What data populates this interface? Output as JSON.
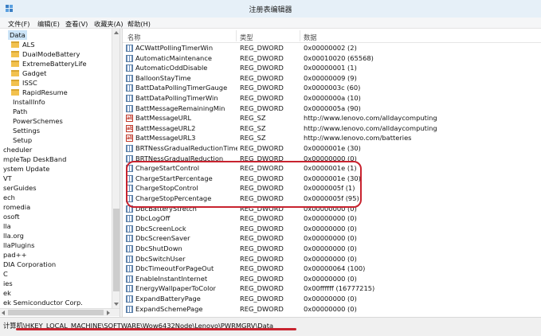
{
  "window": {
    "title": "注册表编辑器"
  },
  "menu": [
    {
      "label": "文件(F)"
    },
    {
      "label": "编辑(E)"
    },
    {
      "label": "查看(V)"
    },
    {
      "label": "收藏夹(A)"
    },
    {
      "label": "帮助(H)"
    }
  ],
  "tree": {
    "items": [
      {
        "label": "Data",
        "folder": false,
        "selected": true
      },
      {
        "label": "ALS",
        "folder": true
      },
      {
        "label": "DualModeBattery",
        "folder": true
      },
      {
        "label": "ExtremeBatteryLife",
        "folder": true
      },
      {
        "label": "Gadget",
        "folder": true
      },
      {
        "label": "ISSC",
        "folder": true
      },
      {
        "label": "RapidResume",
        "folder": true
      },
      {
        "label": "InstallInfo",
        "folder": false
      },
      {
        "label": "Path",
        "folder": false
      },
      {
        "label": "PowerSchemes",
        "folder": false
      },
      {
        "label": "Settings",
        "folder": false
      },
      {
        "label": "Setup",
        "folder": false
      },
      {
        "label": "cheduler",
        "folder": false
      },
      {
        "label": "mpleTap DeskBand",
        "folder": false
      },
      {
        "label": "ystem Update",
        "folder": false
      },
      {
        "label": "VT",
        "folder": false
      },
      {
        "label": "serGuides",
        "folder": false
      },
      {
        "label": "ech",
        "folder": false
      },
      {
        "label": "romedia",
        "folder": false
      },
      {
        "label": "osoft",
        "folder": false
      },
      {
        "label": "lla",
        "folder": false
      },
      {
        "label": "lla.org",
        "folder": false
      },
      {
        "label": "llaPlugins",
        "folder": false
      },
      {
        "label": "pad++",
        "folder": false
      },
      {
        "label": "DIA Corporation",
        "folder": false
      },
      {
        "label": "C",
        "folder": false
      },
      {
        "label": "ies",
        "folder": false
      },
      {
        "label": "ek",
        "folder": false
      },
      {
        "label": "ek Semiconductor Corp.",
        "folder": false
      }
    ]
  },
  "list": {
    "columns": {
      "name": "名称",
      "type": "类型",
      "data": "数据"
    },
    "rows": [
      {
        "name": "ACWattPollingTimerWin",
        "type": "REG_DWORD",
        "data": "0x00000002 (2)",
        "icon": "binary-value-icon"
      },
      {
        "name": "AutomaticMaintenance",
        "type": "REG_DWORD",
        "data": "0x00010020 (65568)",
        "icon": "binary-value-icon"
      },
      {
        "name": "AutomaticOddDisable",
        "type": "REG_DWORD",
        "data": "0x00000001 (1)",
        "icon": "binary-value-icon"
      },
      {
        "name": "BalloonStayTime",
        "type": "REG_DWORD",
        "data": "0x00000009 (9)",
        "icon": "binary-value-icon"
      },
      {
        "name": "BattDataPollingTimerGauge",
        "type": "REG_DWORD",
        "data": "0x0000003c (60)",
        "icon": "binary-value-icon"
      },
      {
        "name": "BattDataPollingTimerWin",
        "type": "REG_DWORD",
        "data": "0x0000000a (10)",
        "icon": "binary-value-icon"
      },
      {
        "name": "BattMessageRemainingMin",
        "type": "REG_DWORD",
        "data": "0x0000005a (90)",
        "icon": "binary-value-icon"
      },
      {
        "name": "BattMessageURL",
        "type": "REG_SZ",
        "data": "http://www.lenovo.com/alldaycomputing",
        "icon": "string-value-icon"
      },
      {
        "name": "BattMessageURL2",
        "type": "REG_SZ",
        "data": "http://www.lenovo.com/alldaycomputing",
        "icon": "string-value-icon"
      },
      {
        "name": "BattMessageURL3",
        "type": "REG_SZ",
        "data": "http://www.lenovo.com/batteries",
        "icon": "string-value-icon"
      },
      {
        "name": "BRTNessGradualReductionTimer",
        "type": "REG_DWORD",
        "data": "0x0000001e (30)",
        "icon": "binary-value-icon"
      },
      {
        "name": "BRTNessGradualReduction",
        "type": "REG_DWORD",
        "data": "0x00000000 (0)",
        "icon": "binary-value-icon"
      },
      {
        "name": "ChargeStartControl",
        "type": "REG_DWORD",
        "data": "0x0000001e (1)",
        "icon": "binary-value-icon"
      },
      {
        "name": "ChargeStartPercentage",
        "type": "REG_DWORD",
        "data": "0x0000001e (30)",
        "icon": "binary-value-icon"
      },
      {
        "name": "ChargeStopControl",
        "type": "REG_DWORD",
        "data": "0x0000005f (1)",
        "icon": "binary-value-icon"
      },
      {
        "name": "ChargeStopPercentage",
        "type": "REG_DWORD",
        "data": "0x0000005f (95)",
        "icon": "binary-value-icon"
      },
      {
        "name": "DbcBatteryStretch",
        "type": "REG_DWORD",
        "data": "0x00000000 (0)",
        "icon": "binary-value-icon"
      },
      {
        "name": "DbcLogOff",
        "type": "REG_DWORD",
        "data": "0x00000000 (0)",
        "icon": "binary-value-icon"
      },
      {
        "name": "DbcScreenLock",
        "type": "REG_DWORD",
        "data": "0x00000000 (0)",
        "icon": "binary-value-icon"
      },
      {
        "name": "DbcScreenSaver",
        "type": "REG_DWORD",
        "data": "0x00000000 (0)",
        "icon": "binary-value-icon"
      },
      {
        "name": "DbcShutDown",
        "type": "REG_DWORD",
        "data": "0x00000000 (0)",
        "icon": "binary-value-icon"
      },
      {
        "name": "DbcSwitchUser",
        "type": "REG_DWORD",
        "data": "0x00000000 (0)",
        "icon": "binary-value-icon"
      },
      {
        "name": "DbcTimeoutForPageOut",
        "type": "REG_DWORD",
        "data": "0x00000064 (100)",
        "icon": "binary-value-icon"
      },
      {
        "name": "EnableInstantInternet",
        "type": "REG_DWORD",
        "data": "0x00000000 (0)",
        "icon": "binary-value-icon"
      },
      {
        "name": "EnergyWallpaperToColor",
        "type": "REG_DWORD",
        "data": "0x00ffffff (16777215)",
        "icon": "binary-value-icon"
      },
      {
        "name": "ExpandBatteryPage",
        "type": "REG_DWORD",
        "data": "0x00000000 (0)",
        "icon": "binary-value-icon"
      },
      {
        "name": "ExpandSchemePage",
        "type": "REG_DWORD",
        "data": "0x00000000 (0)",
        "icon": "binary-value-icon"
      }
    ]
  },
  "status": {
    "path": "计算机\\HKEY_LOCAL_MACHINE\\SOFTWARE\\Wow6432Node\\Lenovo\\PWRMGRV\\Data"
  },
  "colors": {
    "annotation": "#c8232f",
    "selection": "#cce4f7"
  }
}
